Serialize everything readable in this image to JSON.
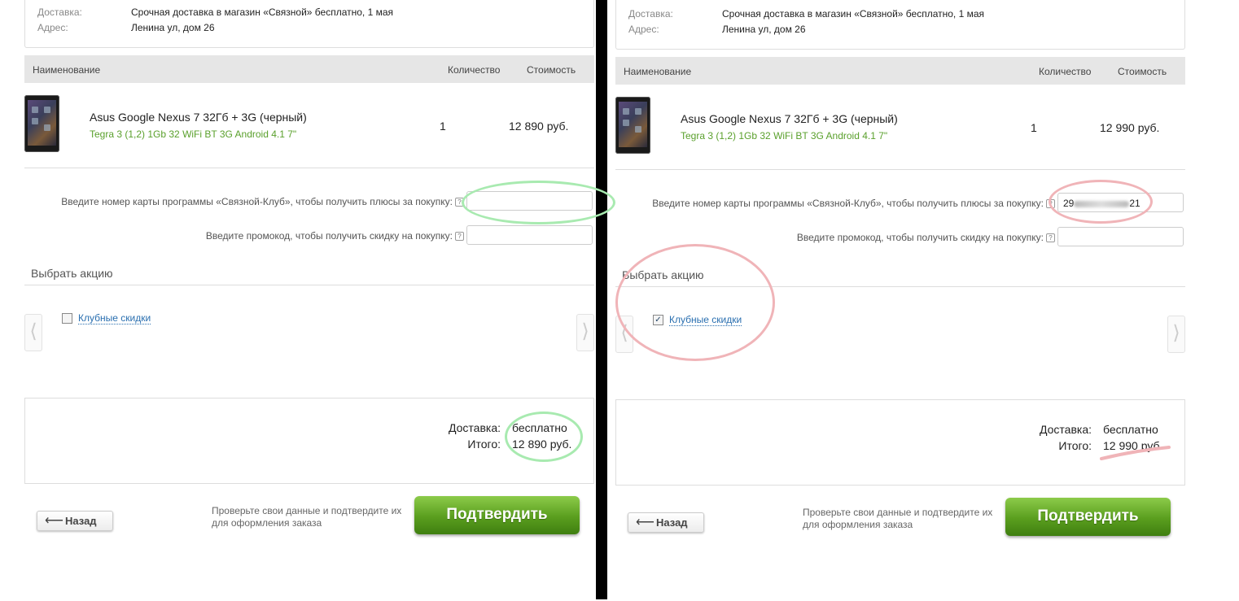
{
  "left": {
    "delivery_label": "Доставка:",
    "delivery_value": "Срочная доставка в магазин «Связной»  бесплатно, 1 мая",
    "address_label": "Адрес:",
    "address_value": "Ленина ул, дом 26",
    "col_name": "Наименование",
    "col_qty": "Количество",
    "col_price": "Стоимость",
    "product_name": "Asus Google Nexus 7 32Гб + 3G (черный)",
    "product_specs": "Tegra 3 (1,2) 1Gb 32 WiFi BT 3G Android 4.1 7\"",
    "quantity": "1",
    "price": "12 890 руб.",
    "card_label": "Введите номер карты программы «Связной-Клуб», чтобы получить плюсы за покупку:",
    "card_value": "",
    "promo_label": "Введите промокод, чтобы получить скидку на покупку:",
    "promo_value": "",
    "help_glyph": "?",
    "section_title": "Выбрать акцию",
    "promo_option": "Клубные скидки",
    "promo_checked": false,
    "sum_delivery_label": "Доставка:",
    "sum_delivery_value": "бесплатно",
    "sum_total_label": "Итого:",
    "sum_total_value": "12 890 руб.",
    "back_arrow": "⟵",
    "back_label": "Назад",
    "hint_text": "Проверьте свои данные и подтвердите их для оформления заказа",
    "confirm_label": "Подтвердить",
    "prev_glyph": "⟨",
    "next_glyph": "⟩"
  },
  "right": {
    "delivery_label": "Доставка:",
    "delivery_value": "Срочная доставка в магазин «Связной»  бесплатно, 1 мая",
    "address_label": "Адрес:",
    "address_value": "Ленина ул, дом 26",
    "col_name": "Наименование",
    "col_qty": "Количество",
    "col_price": "Стоимость",
    "product_name": "Asus Google Nexus 7 32Гб + 3G (черный)",
    "product_specs": "Tegra 3 (1,2) 1Gb 32 WiFi BT 3G Android 4.1 7\"",
    "quantity": "1",
    "price": "12 990 руб.",
    "card_label": "Введите номер карты программы «Связной-Клуб», чтобы получить плюсы за покупку:",
    "card_prefix": "29",
    "card_suffix": "21",
    "promo_label": "Введите промокод, чтобы получить скидку на покупку:",
    "promo_value": "",
    "help_glyph": "?",
    "section_title": "Выбрать акцию",
    "promo_option": "Клубные скидки",
    "promo_checked": true,
    "check_glyph": "✓",
    "sum_delivery_label": "Доставка:",
    "sum_delivery_value": "бесплатно",
    "sum_total_label": "Итого:",
    "sum_total_value": "12 990 руб.",
    "back_arrow": "⟵",
    "back_label": "Назад",
    "hint_text": "Проверьте свои данные и подтвердите их для оформления заказа",
    "confirm_label": "Подтвердить",
    "prev_glyph": "⟨",
    "next_glyph": "⟩"
  },
  "colors": {
    "annotation_green": "#a8eab0",
    "annotation_red": "#f0b4b8",
    "spec_green": "#5aa02c",
    "link_blue": "#2a6fb0",
    "confirm_green": "#5a9e1e"
  }
}
